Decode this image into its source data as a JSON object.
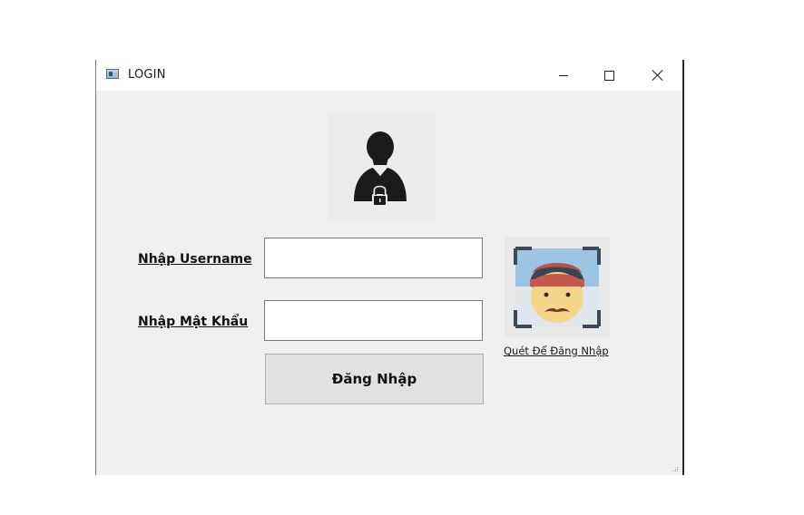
{
  "window": {
    "title": "LOGIN"
  },
  "form": {
    "username_label": "Nhập Username",
    "username_value": "",
    "password_label": "Nhập Mật Khẩu",
    "password_value": "",
    "login_button_label": "Đăng Nhập"
  },
  "face_login": {
    "link_label": "Quét Để Đăng Nhập"
  },
  "icons": {
    "user": "user-lock-icon",
    "face_scan": "face-scan-icon",
    "window": "app-window-icon",
    "minimize": "minimize-icon",
    "maximize": "maximize-icon",
    "close": "close-icon"
  },
  "colors": {
    "window_bg": "#f0f0f0",
    "button_bg": "#e1e1e1",
    "input_border": "#7a7a7a"
  }
}
